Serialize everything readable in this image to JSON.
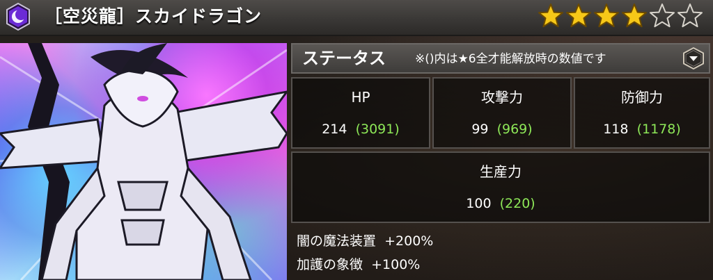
{
  "header": {
    "attribute_icon": "crescent-moon-icon",
    "title": "［空災龍］スカイドラゴン",
    "stars": {
      "filled": 4,
      "total": 6
    }
  },
  "status": {
    "title": "ステータス",
    "note": "※()内は★6全才能解放時の数値です",
    "stats": [
      {
        "label": "HP",
        "value": "214",
        "max_value": "(3091)"
      },
      {
        "label": "攻撃力",
        "value": "99",
        "max_value": "(969)"
      },
      {
        "label": "防御力",
        "value": "118",
        "max_value": "(1178)"
      }
    ],
    "production": {
      "label": "生産力",
      "value": "100",
      "max_value": "(220)"
    }
  },
  "bonuses": [
    {
      "name": "闇の魔法装置",
      "value": "+200%"
    },
    {
      "name": "加護の象徴",
      "value": "+100%"
    }
  ],
  "colors": {
    "star_filled": "#f7c818",
    "bonus_green": "#8ee858",
    "attribute_purple": "#6b2bd6"
  }
}
